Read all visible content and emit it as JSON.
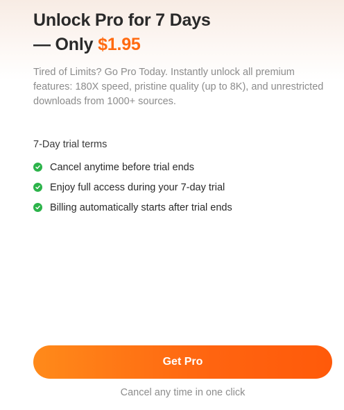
{
  "header": {
    "title_line1": "Unlock Pro for 7 Days",
    "title_prefix": "— Only ",
    "price": "$1.95"
  },
  "description": "Tired of Limits? Go Pro Today. Instantly unlock all premium features: 180X speed, pristine quality (up to 8K), and unrestricted downloads from 1000+ sources.",
  "terms": {
    "heading": "7-Day trial terms",
    "items": [
      "Cancel anytime before trial ends",
      "Enjoy full access during your 7-day trial",
      "Billing automatically starts after trial ends"
    ]
  },
  "cta": {
    "label": "Get Pro"
  },
  "footnote": "Cancel any time in one click",
  "colors": {
    "accent": "#ff6a10",
    "check": "#2cb34a",
    "text_dark": "#2a2a2a",
    "text_muted": "#8c8c8c"
  },
  "icons": {
    "check": "check-circle-icon"
  }
}
